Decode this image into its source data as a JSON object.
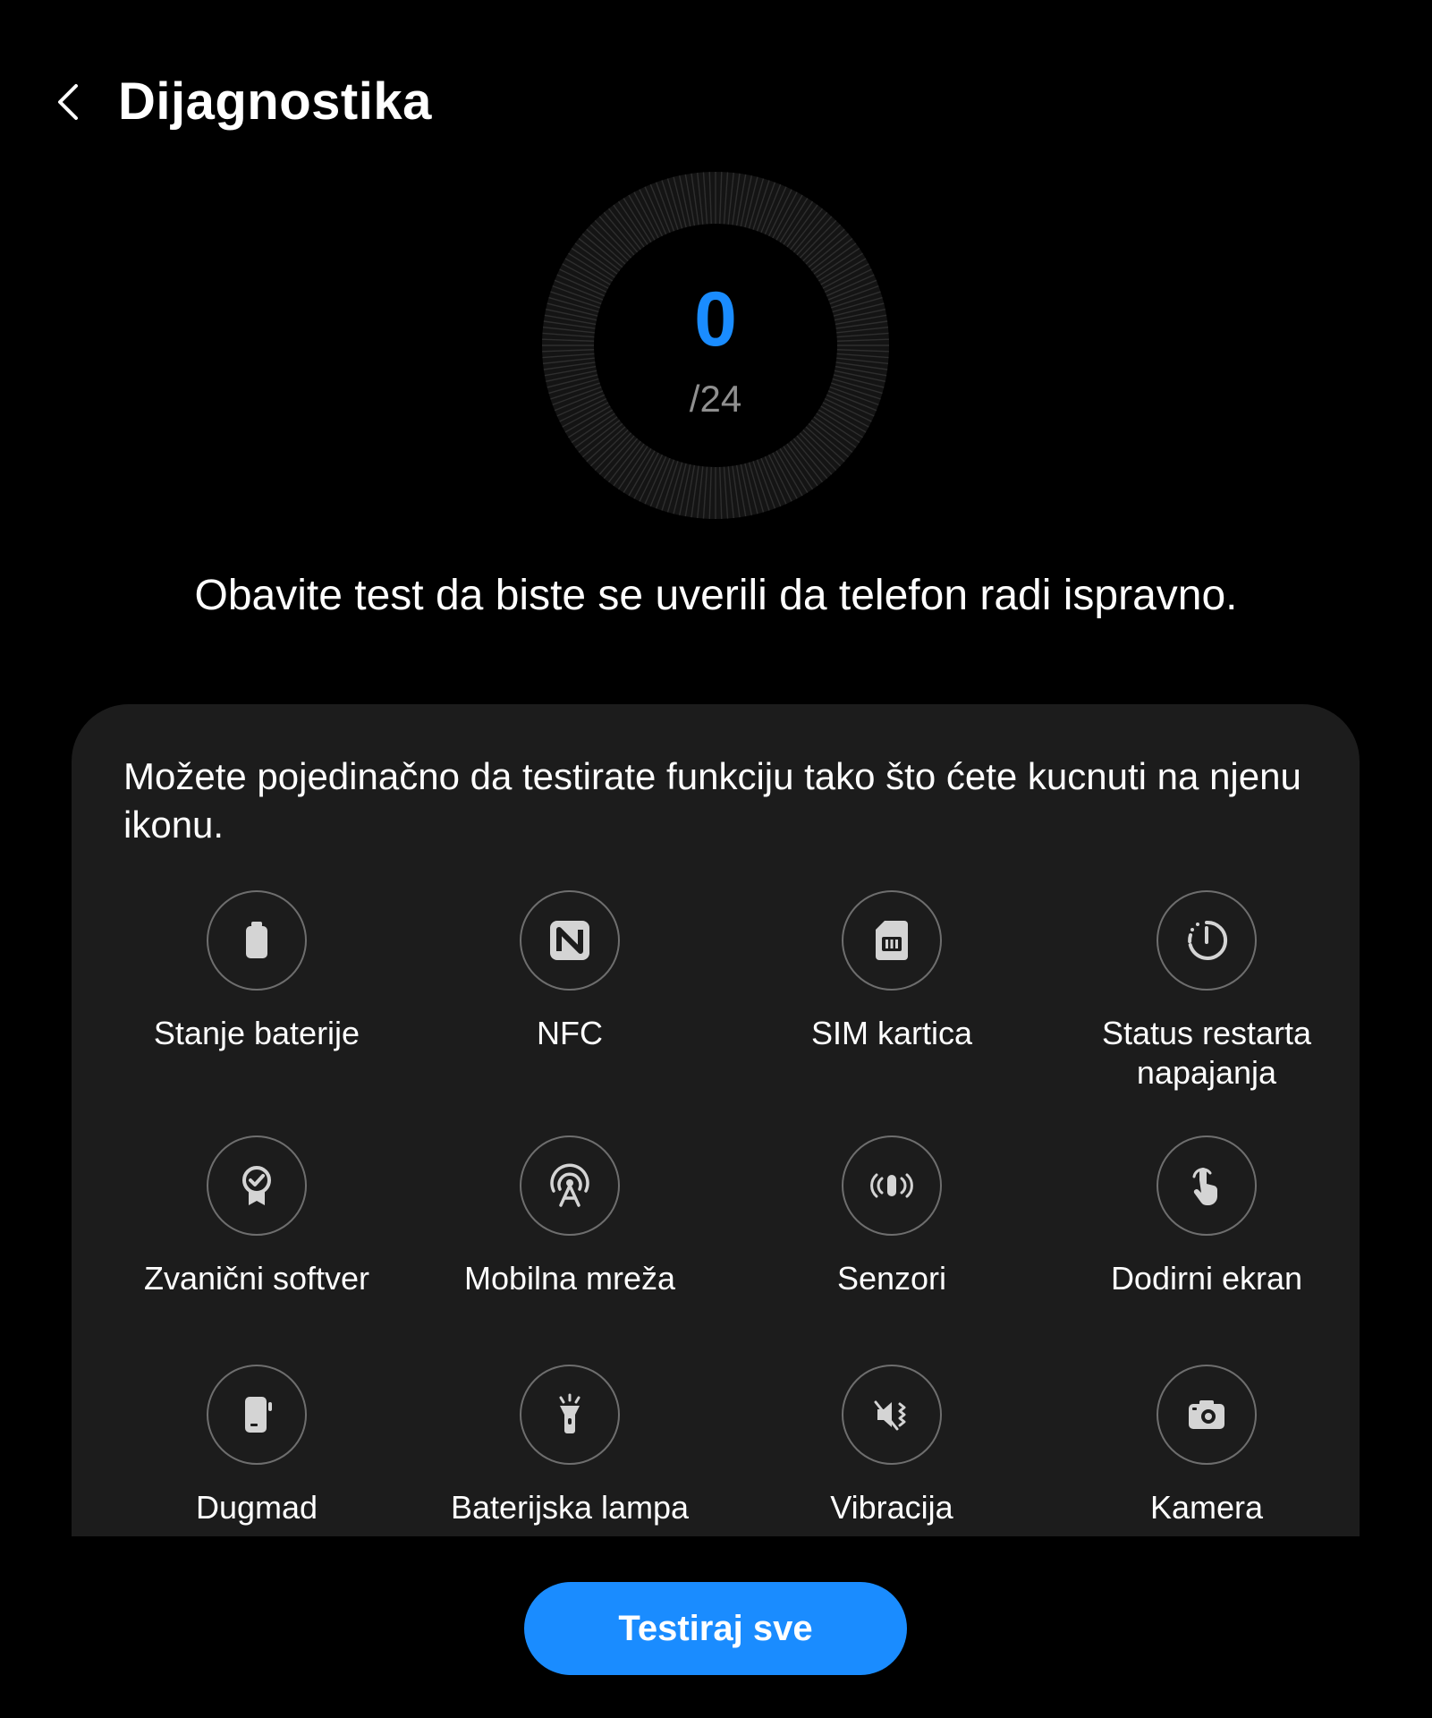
{
  "header": {
    "title": "Dijagnostika",
    "back_icon": "chevron-left-icon"
  },
  "score": {
    "value": "0",
    "total": "/24",
    "accent_color": "#1a8cff"
  },
  "intro": {
    "text": "Obavite test da biste se uverili da telefon radi ispravno."
  },
  "card": {
    "description": "Možete pojedinačno da testirate funkciju tako što ćete kucnuti na njenu ikonu.",
    "items": [
      {
        "label": "Stanje baterije",
        "icon": "battery-icon"
      },
      {
        "label": "NFC",
        "icon": "nfc-icon"
      },
      {
        "label": "SIM kartica",
        "icon": "sim-card-icon"
      },
      {
        "label": "Status restarta napajanja",
        "icon": "power-restart-icon"
      },
      {
        "label": "Zvanični softver",
        "icon": "certified-badge-icon"
      },
      {
        "label": "Mobilna mreža",
        "icon": "cell-tower-icon"
      },
      {
        "label": "Senzori",
        "icon": "sensor-vibrate-icon"
      },
      {
        "label": "Dodirni ekran",
        "icon": "touch-hand-icon"
      },
      {
        "label": "Dugmad",
        "icon": "phone-buttons-icon"
      },
      {
        "label": "Baterijska lampa",
        "icon": "flashlight-icon"
      },
      {
        "label": "Vibracija",
        "icon": "vibration-mute-icon"
      },
      {
        "label": "Kamera",
        "icon": "camera-icon"
      }
    ]
  },
  "footer": {
    "test_all_label": "Testiraj sve",
    "button_color": "#1a8cff"
  }
}
